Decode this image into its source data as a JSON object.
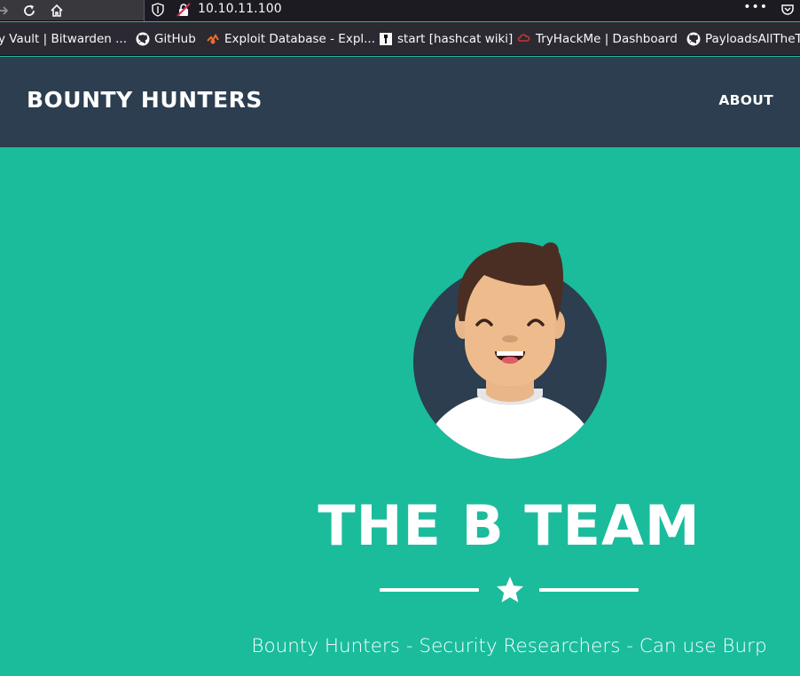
{
  "browser": {
    "url": "10.10.11.100",
    "page_actions_label": "•••"
  },
  "bookmarks": [
    {
      "label": "y Vault | Bitwarden ...",
      "icon": "bitwarden-icon"
    },
    {
      "label": "GitHub",
      "icon": "github-icon"
    },
    {
      "label": "Exploit Database - Expl...",
      "icon": "exploit-db-icon"
    },
    {
      "label": "start [hashcat wiki]",
      "icon": "hashcat-icon"
    },
    {
      "label": "TryHackMe | Dashboard",
      "icon": "tryhackme-icon"
    },
    {
      "label": "PayloadsAllTheT",
      "icon": "github-icon"
    }
  ],
  "site": {
    "brand": "BOUNTY HUNTERS",
    "nav": {
      "about": "ABOUT"
    },
    "masthead": {
      "title": "THE B TEAM",
      "subtitle": "Bounty Hunters - Security Researchers - Can use Burp"
    }
  },
  "colors": {
    "navbar": "#2c3e50",
    "masthead": "#1abc9c",
    "avatar_circle": "#2c3e50",
    "text": "#ffffff"
  }
}
